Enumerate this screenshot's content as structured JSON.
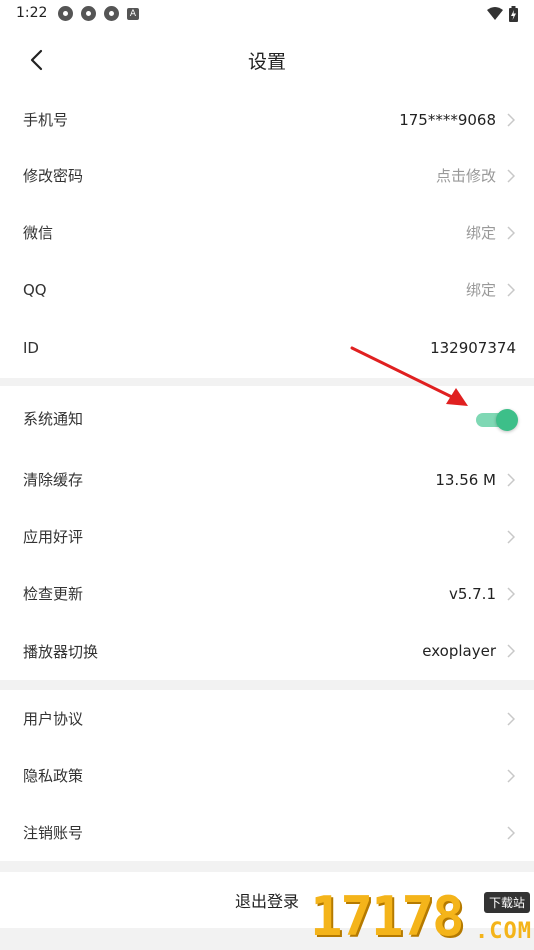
{
  "status_bar": {
    "time": "1:22",
    "left_icons": [
      "notification-icon",
      "notification-icon",
      "notification-icon",
      "a-icon"
    ],
    "a_icon_text": "A",
    "right_icons": [
      "wifi-icon",
      "battery-icon"
    ]
  },
  "header": {
    "title": "设置",
    "back_icon": "chevron-left-icon"
  },
  "groups": [
    {
      "items": [
        {
          "label": "手机号",
          "value": "175****9068"
        },
        {
          "label": "修改密码",
          "value": "点击修改"
        },
        {
          "label": "微信",
          "value": "绑定"
        },
        {
          "label": "QQ",
          "value": "绑定"
        },
        {
          "label": "ID",
          "value": "132907374"
        }
      ]
    },
    {
      "items": [
        {
          "label": "系统通知",
          "toggle_on": true
        },
        {
          "label": "清除缓存",
          "value": "13.56 M"
        },
        {
          "label": "应用好评",
          "value": ""
        },
        {
          "label": "检查更新",
          "value": "v5.7.1"
        },
        {
          "label": "播放器切换",
          "value": "exoplayer"
        }
      ]
    },
    {
      "items": [
        {
          "label": "用户协议"
        },
        {
          "label": "隐私政策"
        },
        {
          "label": "注销账号"
        }
      ]
    }
  ],
  "logout": {
    "label": "退出登录"
  },
  "watermark": {
    "digits": "17178",
    "tag": "下载站",
    "domain": ".COM"
  },
  "colors": {
    "accent": "#3dbf89",
    "annotation_arrow": "#e02020",
    "watermark": "#f4b41a"
  }
}
